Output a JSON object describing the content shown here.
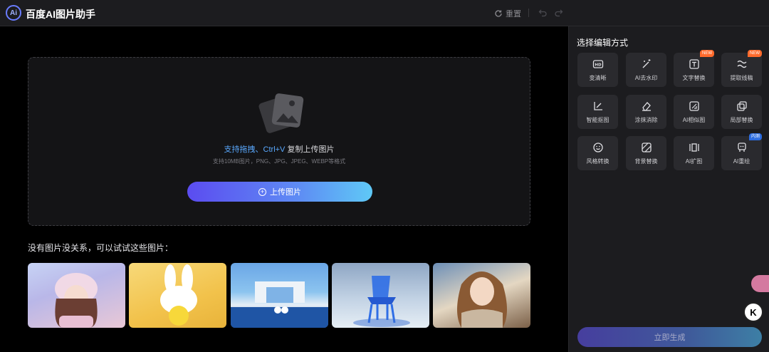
{
  "header": {
    "logo_text": "Ai",
    "title": "百度AI图片助手",
    "reset_label": "重置"
  },
  "upload": {
    "tip_highlight": "支持拖拽、Ctrl+V",
    "tip_rest": " 复制上传图片",
    "sub": "支持10MB图片，PNG、JPG、JPEG、WEBP等格式",
    "button_label": "上传图片"
  },
  "samples": {
    "title": "没有图片没关系，可以试试这些图片："
  },
  "side": {
    "title": "选择编辑方式",
    "tools": [
      {
        "label": "变清晰",
        "icon": "hd-icon",
        "badge": ""
      },
      {
        "label": "AI去水印",
        "icon": "magic-wand-icon",
        "badge": ""
      },
      {
        "label": "文字替换",
        "icon": "text-replace-icon",
        "badge": "NEW"
      },
      {
        "label": "提取线稿",
        "icon": "line-art-icon",
        "badge": "NEW"
      },
      {
        "label": "智能抠图",
        "icon": "cutout-icon",
        "badge": ""
      },
      {
        "label": "涂抹消除",
        "icon": "eraser-icon",
        "badge": ""
      },
      {
        "label": "AI相似图",
        "icon": "similar-image-icon",
        "badge": ""
      },
      {
        "label": "局部替换",
        "icon": "local-replace-icon",
        "badge": ""
      },
      {
        "label": "风格转换",
        "icon": "style-icon",
        "badge": ""
      },
      {
        "label": "背景替换",
        "icon": "background-icon",
        "badge": ""
      },
      {
        "label": "AI扩图",
        "icon": "expand-icon",
        "badge": ""
      },
      {
        "label": "AI重绘",
        "icon": "redraw-icon",
        "badge": "内测"
      }
    ],
    "cta_label": "立即生成"
  },
  "float": {
    "k_label": "K"
  },
  "colors": {
    "accent_start": "#5b4cf0",
    "accent_end": "#5fc9f6",
    "badge_new": "#ff6a2c"
  }
}
